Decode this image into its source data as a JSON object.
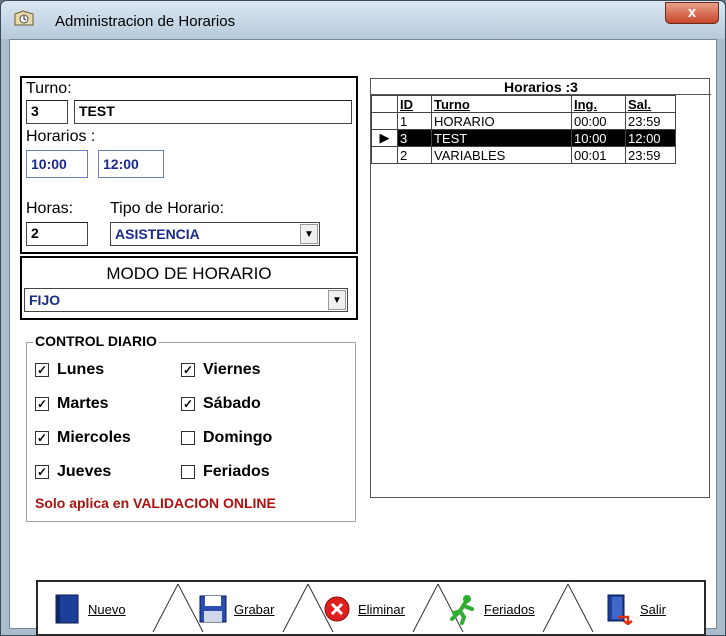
{
  "window": {
    "title": "Administracion de Horarios",
    "close_glyph": "x"
  },
  "turno": {
    "label": "Turno:",
    "id_value": "3",
    "name_value": "TEST"
  },
  "horarios": {
    "label": "Horarios :",
    "start": "10:00",
    "end": "12:00"
  },
  "horas": {
    "label": "Horas:",
    "value": "2"
  },
  "tipo": {
    "label": "Tipo de Horario:",
    "selected": "ASISTENCIA"
  },
  "modo": {
    "label": "MODO DE HORARIO",
    "selected": "FIJO"
  },
  "control": {
    "label": "CONTROL DIARIO",
    "days": [
      {
        "label": "Lunes",
        "checked": true
      },
      {
        "label": "Martes",
        "checked": true
      },
      {
        "label": "Miercoles",
        "checked": true
      },
      {
        "label": "Jueves",
        "checked": true
      },
      {
        "label": "Viernes",
        "checked": true
      },
      {
        "label": "Sábado",
        "checked": true
      },
      {
        "label": "Domingo",
        "checked": false
      },
      {
        "label": "Feriados",
        "checked": false
      }
    ],
    "note": "Solo aplica en VALIDACION ONLINE"
  },
  "grid": {
    "title": "Horarios :3",
    "columns": [
      "ID",
      "Turno",
      "Ing.",
      "Sal."
    ],
    "rows": [
      {
        "id": "1",
        "turno": "HORARIO",
        "ing": "00:00",
        "sal": "23:59",
        "selected": false
      },
      {
        "id": "3",
        "turno": "TEST",
        "ing": "10:00",
        "sal": "12:00",
        "selected": true
      },
      {
        "id": "2",
        "turno": "VARIABLES",
        "ing": "00:01",
        "sal": "23:59",
        "selected": false
      }
    ],
    "row_indicator": "▶"
  },
  "toolbar": {
    "nuevo": "Nuevo",
    "grabar": "Grabar",
    "eliminar": "Eliminar",
    "feriados": "Feriados",
    "salir": "Salir"
  },
  "colors": {
    "accent": "#1a2a8a",
    "note": "#b01010",
    "selection": "#000000"
  }
}
